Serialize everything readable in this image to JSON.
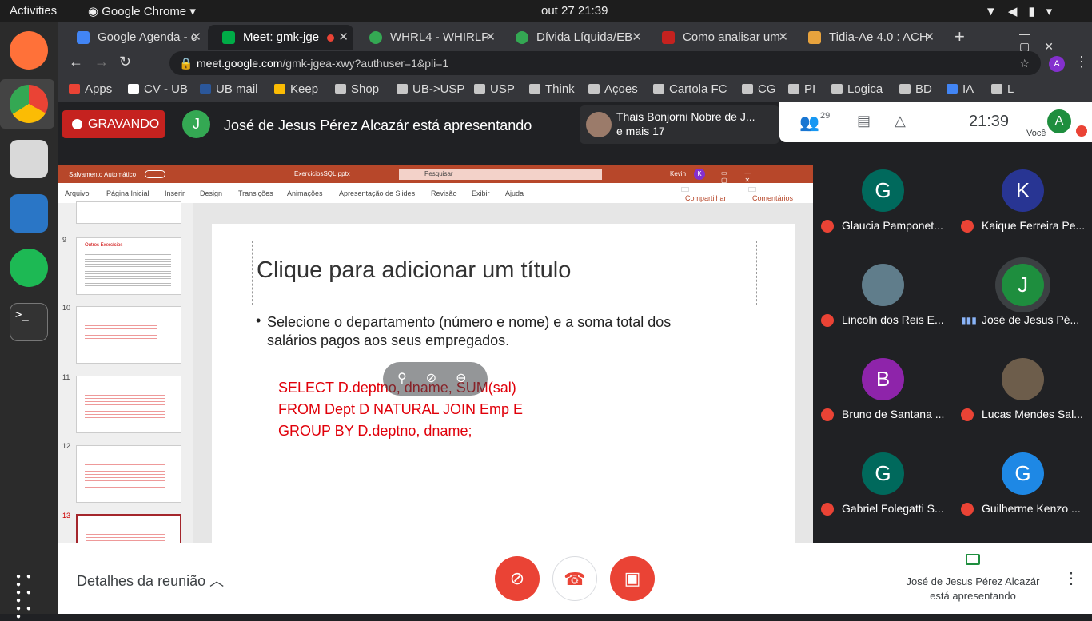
{
  "system_bar": {
    "activities": "Activities",
    "app": "Google Chrome",
    "datetime": "out 27  21:39"
  },
  "tabs": [
    {
      "title": "Google Agenda - c",
      "color": "#4285f4"
    },
    {
      "title": "Meet: gmk-jge",
      "color": "#00ac47"
    },
    {
      "title": "WHRL4 - WHIRLP",
      "color": "#34a853"
    },
    {
      "title": "Dívida Líquida/EB",
      "color": "#34a853"
    },
    {
      "title": "Como analisar um",
      "color": "#c5221f"
    },
    {
      "title": "Tidia-Ae 4.0 : ACH",
      "color": "#e8a33d"
    }
  ],
  "address": {
    "url_host": "meet.google.com",
    "url_path": "/gmk-jgea-xwy?authuser=1&pli=1"
  },
  "bookmarks": [
    "Apps",
    "CV - UB",
    "UB mail",
    "Keep",
    "Shop",
    "UB->USP",
    "USP",
    "Think",
    "Açoes",
    "Cartola FC",
    "CG",
    "PI",
    "Logica",
    "BD",
    "IA",
    "L"
  ],
  "meet": {
    "recording": "GRAVANDO",
    "presenter_initial": "J",
    "presenting_text": "José de Jesus Pérez Alcazár está apresentando",
    "others_name": "Thais Bonjorni Nobre de J...",
    "others_more": "e mais 17",
    "people_count": "29",
    "clock": "21:39",
    "you_label": "Você",
    "you_initial": "A",
    "details": "Detalhes da reunião",
    "bottom_presenter_line1": "José de Jesus Pérez Alcazár",
    "bottom_presenter_line2": "está apresentando"
  },
  "ppt": {
    "autosave": "Salvamento Automático",
    "filename": "ExerciciosSQL.pptx",
    "search": "Pesquisar",
    "user": "Kevin",
    "user_initial": "K",
    "menu": [
      "Arquivo",
      "Página Inicial",
      "Inserir",
      "Design",
      "Transições",
      "Animações",
      "Apresentação de Slides",
      "Revisão",
      "Exibir",
      "Ajuda"
    ],
    "share": "Compartilhar",
    "comments": "Comentários",
    "thumb_numbers": [
      "9",
      "10",
      "11",
      "12",
      "13"
    ],
    "thumb9_title": "Outros Exercícios",
    "slide_title": "Clique para adicionar um título",
    "bullet": "Selecione o departamento (número e nome)  e a soma total dos salários pagos aos seus empregados.",
    "sql": [
      "SELECT D.deptno, dname, SUM(sal)",
      "FROM Dept D NATURAL JOIN Emp E",
      "GROUP BY D.deptno, dname;"
    ]
  },
  "participants": [
    {
      "name": "Glaucia Pamponet...",
      "initial": "G",
      "color": "#00695c"
    },
    {
      "name": "Kaique Ferreira Pe...",
      "initial": "K",
      "color": "#283593"
    },
    {
      "name": "Lincoln dos Reis E...",
      "initial": "",
      "color": "#607d8b"
    },
    {
      "name": "José de Jesus Pé...",
      "initial": "J",
      "color": "#1e8e3e"
    },
    {
      "name": "Bruno de Santana ...",
      "initial": "B",
      "color": "#8e24aa"
    },
    {
      "name": "Lucas Mendes Sal...",
      "initial": "",
      "color": "#6d5d4b"
    },
    {
      "name": "Gabriel Folegatti S...",
      "initial": "G",
      "color": "#00695c"
    },
    {
      "name": "Guilherme Kenzo ...",
      "initial": "G",
      "color": "#1e88e5"
    }
  ]
}
